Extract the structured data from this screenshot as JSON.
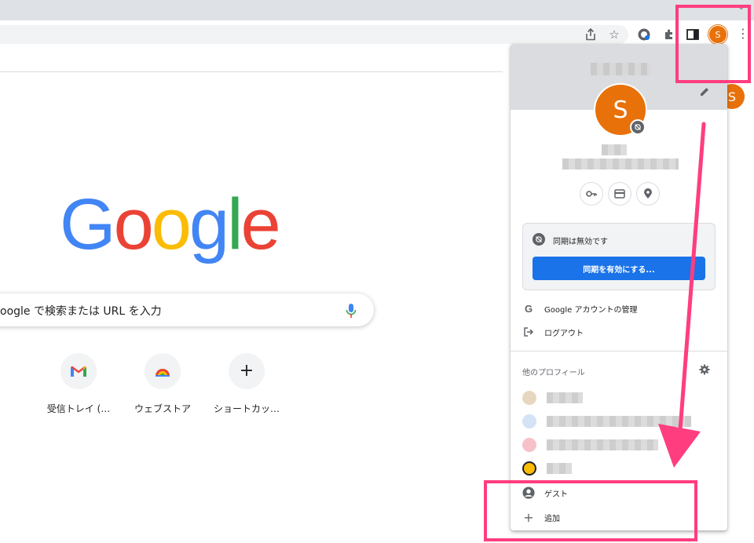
{
  "browser": {
    "profile_initial": "S"
  },
  "ntp": {
    "logo_letters": [
      {
        "ch": "G",
        "color": "#4285F4"
      },
      {
        "ch": "o",
        "color": "#EA4335"
      },
      {
        "ch": "o",
        "color": "#FBBC05"
      },
      {
        "ch": "g",
        "color": "#4285F4"
      },
      {
        "ch": "l",
        "color": "#34A853"
      },
      {
        "ch": "e",
        "color": "#EA4335"
      }
    ],
    "search_placeholder": "oogle で検索または URL を入力",
    "shortcuts": [
      {
        "label": "受信トレイ (…",
        "icon": "gmail-icon"
      },
      {
        "label": "ウェブストア",
        "icon": "webstore-icon"
      },
      {
        "label": "ショートカッ…",
        "icon": "plus-icon"
      }
    ],
    "avatar_initial": "S"
  },
  "popup": {
    "avatar_initial": "S",
    "sync_status": "同期は無効です",
    "sync_button": "同期を有効にする...",
    "manage_account": "Google アカウントの管理",
    "logout": "ログアウト",
    "other_profiles_title": "他のプロフィール",
    "guest": "ゲスト",
    "add": "追加"
  },
  "colors": {
    "accent": "#1a73e8",
    "avatar": "#e8710a",
    "highlight": "#ff3d7f"
  }
}
